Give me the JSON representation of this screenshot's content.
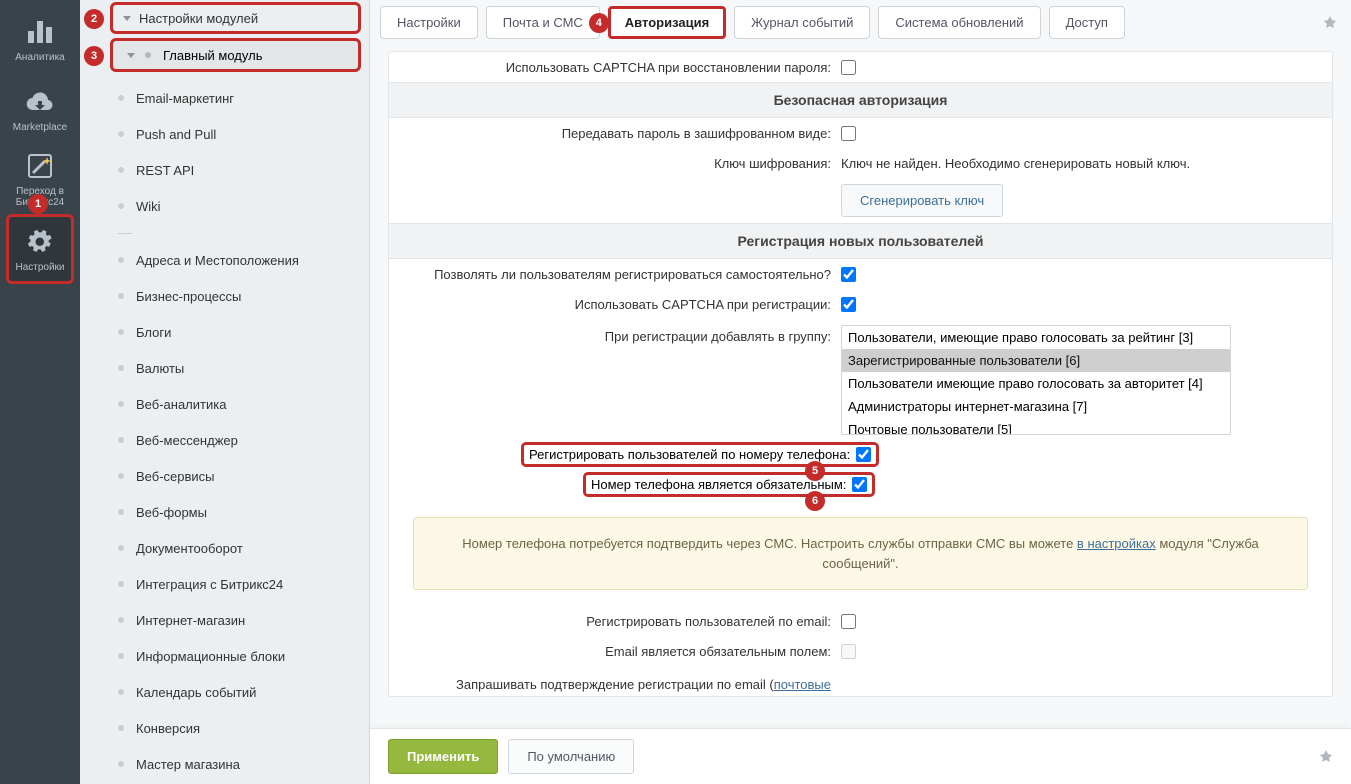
{
  "rail": {
    "analytics": "Аналитика",
    "marketplace": "Marketplace",
    "goto_b24_l1": "Переход в",
    "goto_b24_l2": "Битрикс24",
    "settings": "Настройки"
  },
  "sidebar": {
    "module_settings": "Настройки модулей",
    "main_module": "Главный модуль",
    "items": [
      "Email-маркетинг",
      "Push and Pull",
      "REST API",
      "Wiki",
      "",
      "Адреса и Местоположения",
      "Бизнес-процессы",
      "Блоги",
      "Валюты",
      "Веб-аналитика",
      "Веб-мессенджер",
      "Веб-сервисы",
      "Веб-формы",
      "Документооборот",
      "Интеграция с Битрикс24",
      "Интернет-магазин",
      "Информационные блоки",
      "Календарь событий",
      "Конверсия",
      "Мастер магазина"
    ]
  },
  "tabs": {
    "t1": "Настройки",
    "t2": "Почта и СМС",
    "t3": "Авторизация",
    "t4": "Журнал событий",
    "t5": "Система обновлений",
    "t6": "Доступ"
  },
  "annotations": {
    "a1": "1",
    "a2": "2",
    "a3": "3",
    "a4": "4",
    "a5": "5",
    "a6": "6"
  },
  "form": {
    "captcha_restore": "Использовать CAPTCHA при восстановлении пароля:",
    "section_secure": "Безопасная авторизация",
    "encrypted_pass": "Передавать пароль в зашифрованном виде:",
    "enc_key_label": "Ключ шифрования:",
    "enc_key_value": "Ключ не найден. Необходимо сгенерировать новый ключ.",
    "gen_key_btn": "Сгенерировать ключ",
    "section_register": "Регистрация новых пользователей",
    "allow_selfreg": "Позволять ли пользователям регистрироваться самостоятельно?",
    "captcha_reg": "Использовать CAPTCHA при регистрации:",
    "add_to_group": "При регистрации добавлять в группу:",
    "groups": [
      "Пользователи, имеющие право голосовать за рейтинг [3]",
      "Зарегистрированные пользователи [6]",
      "Пользователи имеющие право голосовать за авторитет [4]",
      "Администраторы интернет-магазина [7]",
      "Почтовые пользователи [5]"
    ],
    "reg_by_phone": "Регистрировать пользователей по номеру телефона:",
    "phone_required": "Номер телефона является обязательным:",
    "info_part1": "Номер телефона потребуется подтвердить через СМС. Настроить службы отправки СМС вы можете ",
    "info_link": "в настройках",
    "info_part2": " модуля \"Служба сообщений\".",
    "reg_by_email": "Регистрировать пользователей по email:",
    "email_required": "Email является обязательным полем:",
    "confirm_email_label": "Запрашивать подтверждение регистрации по email (",
    "confirm_email_link": "почтовые"
  },
  "footer": {
    "apply": "Применить",
    "default": "По умолчанию"
  }
}
